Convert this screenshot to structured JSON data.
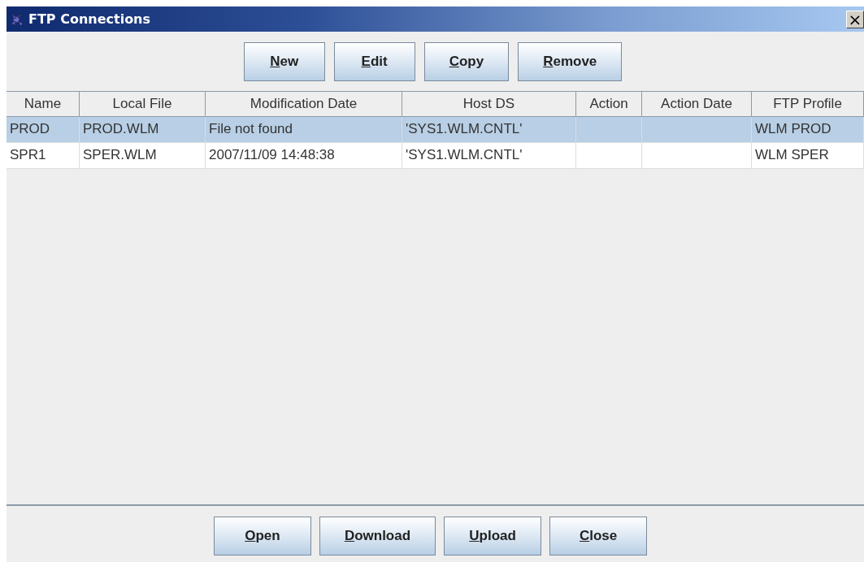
{
  "window": {
    "title": "FTP Connections",
    "close": "×"
  },
  "top_buttons": [
    "New",
    "Edit",
    "Copy",
    "Remove"
  ],
  "table": {
    "columns": [
      "Name",
      "Local File",
      "Modification Date",
      "Host DS",
      "Action",
      "Action Date",
      "FTP Profile"
    ],
    "rows": [
      {
        "selected": true,
        "cells": [
          "PROD",
          "PROD.WLM",
          "File not found",
          "'SYS1.WLM.CNTL'",
          "",
          "",
          "WLM PROD"
        ]
      },
      {
        "selected": false,
        "cells": [
          "SPR1",
          "SPER.WLM",
          "2007/11/09 14:48:38",
          "'SYS1.WLM.CNTL'",
          "",
          "",
          "WLM SPER"
        ]
      }
    ]
  },
  "bottom_buttons": [
    "Open",
    "Download",
    "Upload",
    "Close"
  ]
}
